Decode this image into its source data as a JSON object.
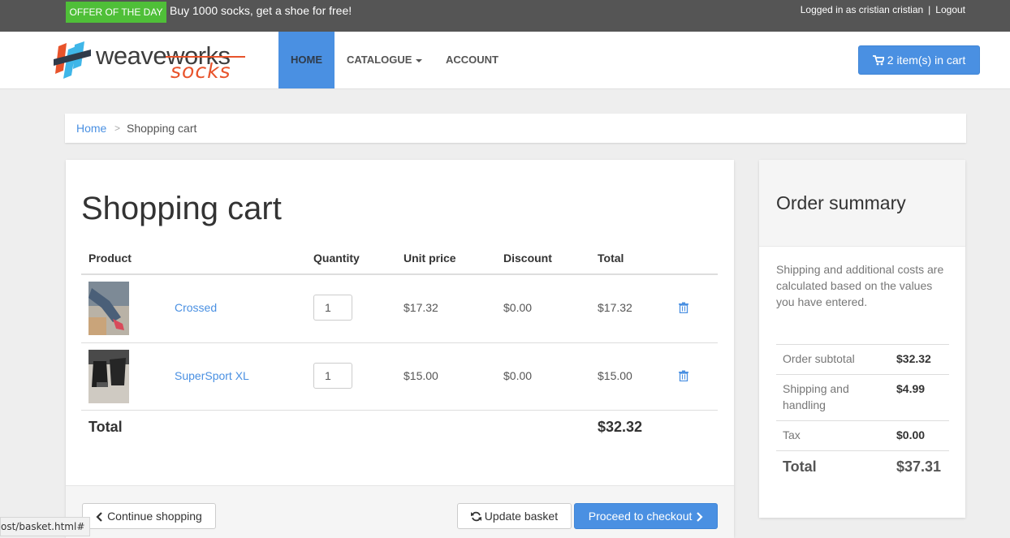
{
  "topbar": {
    "offer_badge": "OFFER OF THE DAY",
    "offer_text": "Buy 1000 socks, get a shoe for free!",
    "logged_in": "Logged in as cristian cristian",
    "separator": "|",
    "logout": "Logout"
  },
  "nav": {
    "logo_brand": "weaveworks",
    "logo_sub": "socks",
    "items": [
      {
        "label": "HOME",
        "active": true
      },
      {
        "label": "CATALOGUE",
        "dropdown": true
      },
      {
        "label": "ACCOUNT"
      }
    ],
    "cart_button": "2 item(s) in cart"
  },
  "breadcrumb": {
    "home": "Home",
    "separator": ">",
    "current": "Shopping cart"
  },
  "cart": {
    "title": "Shopping cart",
    "columns": [
      "Product",
      "Quantity",
      "Unit price",
      "Discount",
      "Total"
    ],
    "items": [
      {
        "name": "Crossed",
        "quantity": "1",
        "unit_price": "$17.32",
        "discount": "$0.00",
        "total": "$17.32"
      },
      {
        "name": "SuperSport XL",
        "quantity": "1",
        "unit_price": "$15.00",
        "discount": "$0.00",
        "total": "$15.00"
      }
    ],
    "total_label": "Total",
    "total_value": "$32.32",
    "buttons": {
      "continue": "Continue shopping",
      "update": "Update basket",
      "checkout": "Proceed to checkout"
    }
  },
  "summary": {
    "title": "Order summary",
    "note": "Shipping and additional costs are calculated based on the values you have entered.",
    "rows": [
      {
        "label": "Order subtotal",
        "value": "$32.32"
      },
      {
        "label": "Shipping and handling",
        "value": "$4.99"
      },
      {
        "label": "Tax",
        "value": "$0.00"
      }
    ],
    "total_label": "Total",
    "total_value": "$37.31"
  },
  "status_url": "ost/basket.html#",
  "colors": {
    "accent": "#4a90e2",
    "offer_green": "#4fbf38",
    "topbar": "#555555",
    "logo_orange": "#e8532b"
  },
  "icons": {
    "cart": "shopping-cart-icon",
    "trash": "trash-icon",
    "continue": "chevron-left-icon",
    "update": "refresh-icon",
    "checkout": "chevron-right-icon"
  }
}
